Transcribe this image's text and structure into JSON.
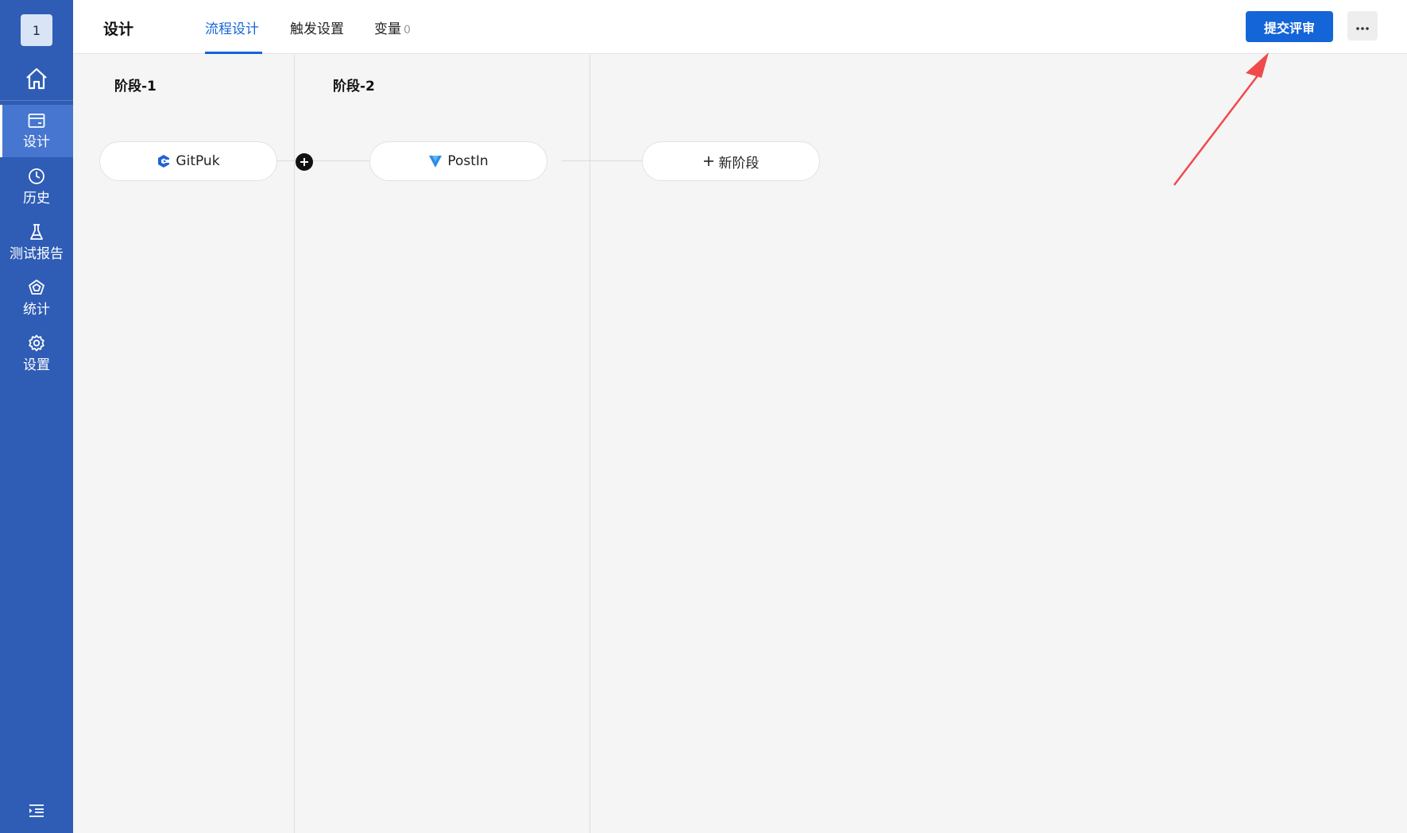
{
  "sidebar": {
    "avatar_text": "1",
    "home_icon": "home-icon",
    "items": [
      {
        "label": "设计",
        "icon": "card-icon",
        "active": true
      },
      {
        "label": "历史",
        "icon": "clock-icon",
        "active": false
      },
      {
        "label": "测试报告",
        "icon": "flask-icon",
        "active": false
      },
      {
        "label": "统计",
        "icon": "pentagon-chart-icon",
        "active": false
      },
      {
        "label": "设置",
        "icon": "gear-icon",
        "active": false
      }
    ],
    "bottom_icon": "collapse-menu-icon"
  },
  "header": {
    "title": "设计",
    "tabs": [
      {
        "label": "流程设计",
        "active": true
      },
      {
        "label": "触发设置",
        "active": false
      },
      {
        "label": "变量",
        "count": "0",
        "active": false
      }
    ],
    "submit_label": "提交评审",
    "more_icon": "ellipsis-icon"
  },
  "stages": [
    {
      "title": "阶段-1",
      "task": "GitPuk",
      "task_icon": "gitpuk-logo-icon"
    },
    {
      "title": "阶段-2",
      "task": "PostIn",
      "task_icon": "postin-logo-icon"
    }
  ],
  "new_stage_label": "新阶段",
  "colors": {
    "sidebar_bg": "#2f5db5",
    "sidebar_active": "#4676cf",
    "primary": "#1465d8",
    "canvas_bg": "#f5f5f5",
    "annotation_arrow": "#f04a4a"
  }
}
